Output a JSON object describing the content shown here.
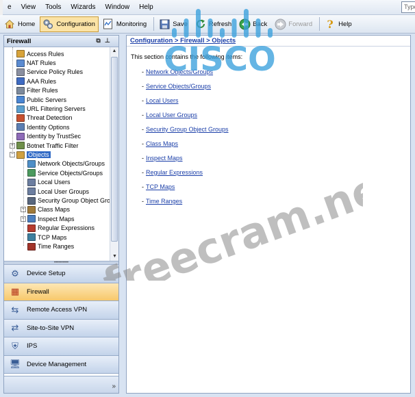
{
  "menubar": {
    "items": [
      "e",
      "View",
      "Tools",
      "Wizards",
      "Window",
      "Help"
    ],
    "search_placeholder": "Type"
  },
  "toolbar": {
    "buttons": [
      {
        "label": "Home",
        "icon": "home-icon",
        "active": false,
        "disabled": false
      },
      {
        "label": "Configuration",
        "icon": "configuration-icon",
        "active": true,
        "disabled": false
      },
      {
        "label": "Monitoring",
        "icon": "monitoring-icon",
        "active": false,
        "disabled": false
      },
      {
        "label": "Save",
        "icon": "save-icon",
        "active": false,
        "disabled": false
      },
      {
        "label": "Refresh",
        "icon": "refresh-icon",
        "active": false,
        "disabled": false
      },
      {
        "label": "Back",
        "icon": "back-icon",
        "active": false,
        "disabled": false
      },
      {
        "label": "Forward",
        "icon": "forward-icon",
        "active": false,
        "disabled": true
      },
      {
        "label": "Help",
        "icon": "help-icon",
        "active": false,
        "disabled": false
      }
    ]
  },
  "nav": {
    "title": "Firewall",
    "tree": [
      {
        "label": "Access Rules",
        "level": 1,
        "icon": "access-rules-icon",
        "expander": ""
      },
      {
        "label": "NAT Rules",
        "level": 1,
        "icon": "nat-rules-icon",
        "expander": ""
      },
      {
        "label": "Service Policy Rules",
        "level": 1,
        "icon": "service-policy-icon",
        "expander": ""
      },
      {
        "label": "AAA Rules",
        "level": 1,
        "icon": "aaa-rules-icon",
        "expander": ""
      },
      {
        "label": "Filter Rules",
        "level": 1,
        "icon": "filter-rules-icon",
        "expander": ""
      },
      {
        "label": "Public Servers",
        "level": 1,
        "icon": "public-servers-icon",
        "expander": ""
      },
      {
        "label": "URL Filtering Servers",
        "level": 1,
        "icon": "url-filtering-icon",
        "expander": ""
      },
      {
        "label": "Threat Detection",
        "level": 1,
        "icon": "threat-detection-icon",
        "expander": ""
      },
      {
        "label": "Identity Options",
        "level": 1,
        "icon": "identity-options-icon",
        "expander": ""
      },
      {
        "label": "Identity by TrustSec",
        "level": 1,
        "icon": "trustsec-icon",
        "expander": ""
      },
      {
        "label": "Botnet Traffic Filter",
        "level": 1,
        "icon": "botnet-icon",
        "expander": "+"
      },
      {
        "label": "Objects",
        "level": 1,
        "icon": "objects-icon",
        "expander": "−",
        "selected": true
      },
      {
        "label": "Network Objects/Groups",
        "level": 2,
        "icon": "network-objects-icon",
        "expander": ""
      },
      {
        "label": "Service Objects/Groups",
        "level": 2,
        "icon": "service-objects-icon",
        "expander": ""
      },
      {
        "label": "Local Users",
        "level": 2,
        "icon": "local-users-icon",
        "expander": ""
      },
      {
        "label": "Local User Groups",
        "level": 2,
        "icon": "local-user-groups-icon",
        "expander": ""
      },
      {
        "label": "Security Group Object Gro",
        "level": 2,
        "icon": "security-group-icon",
        "expander": ""
      },
      {
        "label": "Class Maps",
        "level": 2,
        "icon": "class-maps-icon",
        "expander": "+"
      },
      {
        "label": "Inspect Maps",
        "level": 2,
        "icon": "inspect-maps-icon",
        "expander": "+"
      },
      {
        "label": "Regular Expressions",
        "level": 2,
        "icon": "regex-icon",
        "expander": ""
      },
      {
        "label": "TCP Maps",
        "level": 2,
        "icon": "tcp-maps-icon",
        "expander": ""
      },
      {
        "label": "Time Ranges",
        "level": 2,
        "icon": "time-ranges-icon",
        "expander": ""
      }
    ],
    "sections": [
      {
        "label": "Device Setup",
        "icon": "device-setup-icon",
        "active": false
      },
      {
        "label": "Firewall",
        "icon": "firewall-icon",
        "active": true
      },
      {
        "label": "Remote Access VPN",
        "icon": "remote-access-vpn-icon",
        "active": false
      },
      {
        "label": "Site-to-Site VPN",
        "icon": "site-to-site-vpn-icon",
        "active": false
      },
      {
        "label": "IPS",
        "icon": "ips-icon",
        "active": false
      },
      {
        "label": "Device Management",
        "icon": "device-management-icon",
        "active": false
      }
    ]
  },
  "content": {
    "breadcrumb": "Configuration > Firewall > Objects",
    "intro": "This section contains the following items:",
    "links": [
      "Network Objects/Groups",
      "Service Objects/Groups",
      "Local Users",
      "Local User Groups",
      "Security Group Object Groups",
      "Class Maps",
      "Inspect Maps",
      "Regular Expressions",
      "TCP Maps",
      "Time Ranges"
    ]
  },
  "watermarks": {
    "logo_text": "CISCO",
    "site_text": "freecram.net"
  },
  "colors": {
    "link": "#1a3ea8",
    "selection": "#316ac5",
    "active_section": "#f7c86a",
    "watermark_blue": "#3aa0dc"
  }
}
